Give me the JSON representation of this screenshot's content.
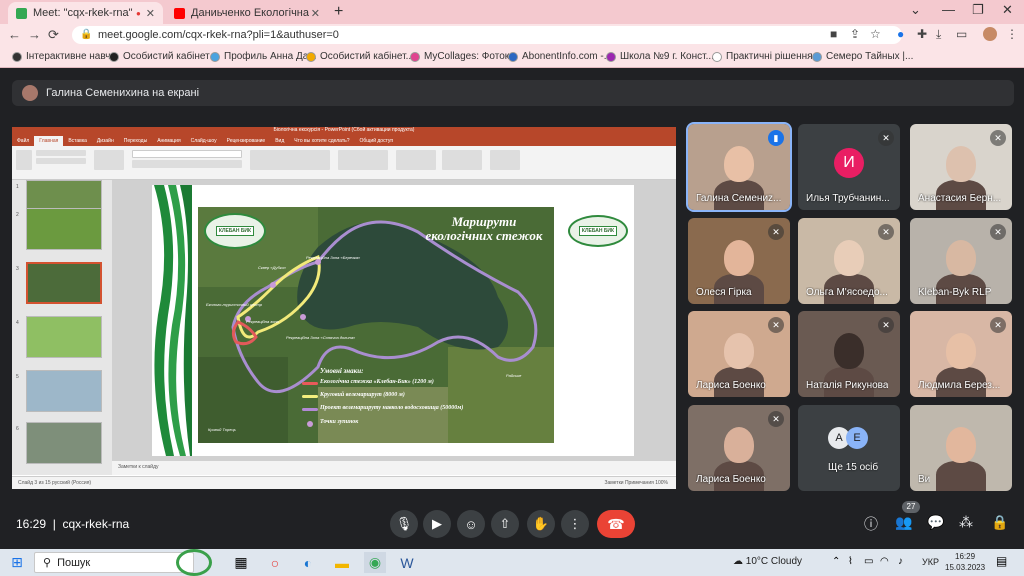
{
  "browser": {
    "tabs": [
      {
        "title": "Meet: \"cqx-rkek-rna\"",
        "fav_color": "#fbbc04"
      },
      {
        "title": "Даниьченко Екологічна стежк",
        "fav_color": "#ff0000"
      }
    ],
    "url": "meet.google.com/cqx-rkek-rna?pli=1&authuser=0",
    "bookmarks": [
      {
        "label": "Інтерактивне навч...",
        "color": "#333"
      },
      {
        "label": "Особистий кабінет",
        "color": "#222"
      },
      {
        "label": "Профиль Анна Да...",
        "color": "#4aa3df"
      },
      {
        "label": "Особистий кабінет...",
        "color": "#f2a900"
      },
      {
        "label": "MyCollages: Фоток...",
        "color": "#e0448f"
      },
      {
        "label": "AbonentInfo.com -...",
        "color": "#2b67c2"
      },
      {
        "label": "Школа №9 г. Конст...",
        "color": "#9c27b0"
      },
      {
        "label": "Практичні рішення...",
        "color": "#ffffff"
      },
      {
        "label": "Семеро Тайных |...",
        "color": "#5b9bd5"
      }
    ]
  },
  "meet": {
    "presenter_banner": "Галина Семенихина на екрані",
    "time": "16:29",
    "meeting_code": "cqx-rkek-rna",
    "people_count": "27",
    "participants": [
      {
        "name": "Галина Семениz...",
        "speaking": true
      },
      {
        "name": "Илья Трубчанин...",
        "initial": "И",
        "initial_color": "#e91e63"
      },
      {
        "name": "Анастасия Берн..."
      },
      {
        "name": "Олеся Гірка"
      },
      {
        "name": "Ольга М'ясоедо..."
      },
      {
        "name": "Kleban-Byk RLP"
      },
      {
        "name": "Лариса Боенко"
      },
      {
        "name": "Наталія Рикунова"
      },
      {
        "name": "Людмила Берез..."
      },
      {
        "name": "Лариса Боенко"
      },
      {
        "name": "Ще 15 осіб",
        "initials": [
          "A",
          "E"
        ]
      },
      {
        "name": "Ви"
      }
    ]
  },
  "ppt": {
    "title": "Біологічна екскурсія - PowerPoint (Сбой активации продукта)",
    "tabs": [
      "Файл",
      "Главная",
      "Вставка",
      "Дизайн",
      "Переходы",
      "Анимация",
      "Слайд-шоу",
      "Рецензирование",
      "Вид",
      "Что вы хотите сделать?",
      "Общий доступ"
    ],
    "slide_numbers": [
      "1",
      "2",
      "3",
      "4",
      "5",
      "6"
    ],
    "notes": "Заметки к слайду",
    "status": "Слайд 3 из 15   русский (Россия)",
    "status_right": "Заметки   Примечания   100%",
    "slide": {
      "map_title": "Маршрути екологічних стежок",
      "logo_text": "КЛЕБАН БИК",
      "legend_title": "Умовні знаки:",
      "legend": [
        {
          "label": "Екологічна стежка «Клебан-Бик» (1200 м)",
          "color": "#e85a5a"
        },
        {
          "label": "Круговий велемаршрут (8000 м)",
          "color": "#f4ef7e"
        },
        {
          "label": "Проект велемаршруту навколо водосховища (50000м)",
          "color": "#b28ad6"
        },
        {
          "label": "Точки зупинок",
          "color": "#c99bd8"
        }
      ],
      "map_labels": [
        "Еколого-туристичний центр",
        "Сквер «Дубки»",
        "Рекреаційна зона",
        "Рекреаційна Зона «Березка»",
        "Рекреаційна Зона «Сонячна долина»",
        "Райське",
        "Кривий Торець"
      ]
    }
  },
  "taskbar": {
    "search": "Пошук",
    "weather": "10°C  Cloudy",
    "lang": "УКР",
    "clock_time": "16:29",
    "clock_date": "15.03.2023"
  },
  "colors": {
    "accent": "#8ab4f8",
    "end_call": "#ea4335",
    "tab_bar": "#f4c9cf"
  }
}
